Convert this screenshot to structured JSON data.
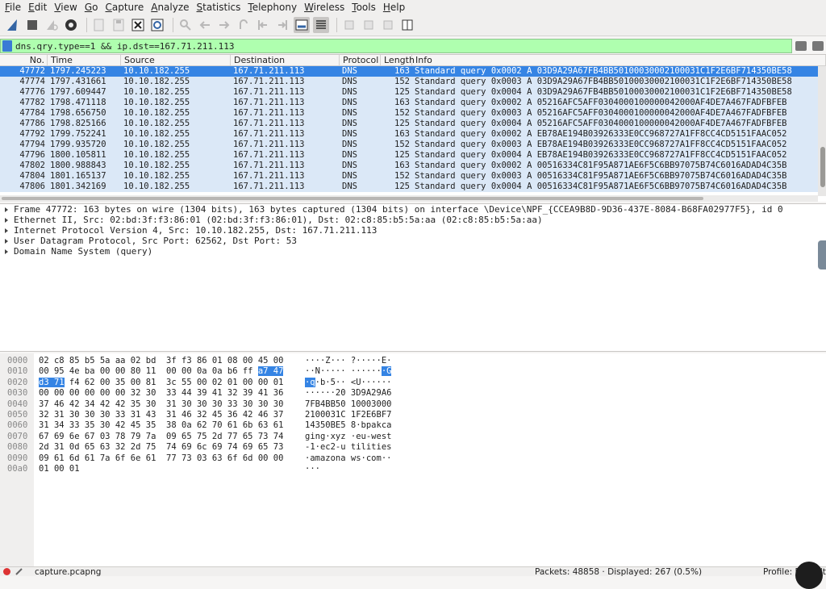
{
  "menu": [
    "File",
    "Edit",
    "View",
    "Go",
    "Capture",
    "Analyze",
    "Statistics",
    "Telephony",
    "Wireless",
    "Tools",
    "Help"
  ],
  "toolbar_icons": [
    "shark-fin-start-icon",
    "stop-icon",
    "restart-icon",
    "options-gear-icon",
    "open-file-icon",
    "save-file-icon",
    "close-file-icon",
    "reload-file-icon",
    "find-icon",
    "back-icon",
    "forward-icon",
    "go-to-packet-icon",
    "first-packet-icon",
    "last-packet-icon",
    "autoscroll-icon",
    "colorize-icon",
    "zoom-in-icon",
    "zoom-out-icon",
    "normal-size-icon",
    "resize-columns-icon"
  ],
  "filter": {
    "value": "dns.qry.type==1 && ip.dst==167.71.211.113"
  },
  "columns": [
    "No.",
    "Time",
    "Source",
    "Destination",
    "Protocol",
    "Length",
    "Info"
  ],
  "packets": [
    {
      "no": "47772",
      "time": "1797.245223",
      "src": "10.10.182.255",
      "dst": "167.71.211.113",
      "proto": "DNS",
      "len": "163",
      "info": "Standard query 0x0002 A 03D9A29A67FB4BB50100030002100031C1F2E6BF714350BE58",
      "selected": true
    },
    {
      "no": "47774",
      "time": "1797.431661",
      "src": "10.10.182.255",
      "dst": "167.71.211.113",
      "proto": "DNS",
      "len": "152",
      "info": "Standard query 0x0003 A 03D9A29A67FB4BB50100030002100031C1F2E6BF714350BE58"
    },
    {
      "no": "47776",
      "time": "1797.609447",
      "src": "10.10.182.255",
      "dst": "167.71.211.113",
      "proto": "DNS",
      "len": "125",
      "info": "Standard query 0x0004 A 03D9A29A67FB4BB50100030002100031C1F2E6BF714350BE58"
    },
    {
      "no": "47782",
      "time": "1798.471118",
      "src": "10.10.182.255",
      "dst": "167.71.211.113",
      "proto": "DNS",
      "len": "163",
      "info": "Standard query 0x0002 A 05216AFC5AFF0304000100000042000AF4DE7A467FADFBFEB"
    },
    {
      "no": "47784",
      "time": "1798.656750",
      "src": "10.10.182.255",
      "dst": "167.71.211.113",
      "proto": "DNS",
      "len": "152",
      "info": "Standard query 0x0003 A 05216AFC5AFF0304000100000042000AF4DE7A467FADFBFEB"
    },
    {
      "no": "47786",
      "time": "1798.825166",
      "src": "10.10.182.255",
      "dst": "167.71.211.113",
      "proto": "DNS",
      "len": "125",
      "info": "Standard query 0x0004 A 05216AFC5AFF0304000100000042000AF4DE7A467FADFBFEB"
    },
    {
      "no": "47792",
      "time": "1799.752241",
      "src": "10.10.182.255",
      "dst": "167.71.211.113",
      "proto": "DNS",
      "len": "163",
      "info": "Standard query 0x0002 A EB78AE194B03926333E0CC968727A1FF8CC4CD5151FAAC052"
    },
    {
      "no": "47794",
      "time": "1799.935720",
      "src": "10.10.182.255",
      "dst": "167.71.211.113",
      "proto": "DNS",
      "len": "152",
      "info": "Standard query 0x0003 A EB78AE194B03926333E0CC968727A1FF8CC4CD5151FAAC052"
    },
    {
      "no": "47796",
      "time": "1800.105811",
      "src": "10.10.182.255",
      "dst": "167.71.211.113",
      "proto": "DNS",
      "len": "125",
      "info": "Standard query 0x0004 A EB78AE194B03926333E0CC968727A1FF8CC4CD5151FAAC052"
    },
    {
      "no": "47802",
      "time": "1800.988843",
      "src": "10.10.182.255",
      "dst": "167.71.211.113",
      "proto": "DNS",
      "len": "163",
      "info": "Standard query 0x0002 A 00516334C81F95A871AE6F5C6BB97075B74C6016ADAD4C35B"
    },
    {
      "no": "47804",
      "time": "1801.165137",
      "src": "10.10.182.255",
      "dst": "167.71.211.113",
      "proto": "DNS",
      "len": "152",
      "info": "Standard query 0x0003 A 00516334C81F95A871AE6F5C6BB97075B74C6016ADAD4C35B"
    },
    {
      "no": "47806",
      "time": "1801.342169",
      "src": "10.10.182.255",
      "dst": "167.71.211.113",
      "proto": "DNS",
      "len": "125",
      "info": "Standard query 0x0004 A 00516334C81F95A871AE6F5C6BB97075B74C6016ADAD4C35B"
    }
  ],
  "details": [
    "Frame 47772: 163 bytes on wire (1304 bits), 163 bytes captured (1304 bits) on interface \\Device\\NPF_{CCEA9B8D-9D36-437E-8084-B68FA02977F5}, id 0",
    "Ethernet II, Src: 02:bd:3f:f3:86:01 (02:bd:3f:f3:86:01), Dst: 02:c8:85:b5:5a:aa (02:c8:85:b5:5a:aa)",
    "Internet Protocol Version 4, Src: 10.10.182.255, Dst: 167.71.211.113",
    "User Datagram Protocol, Src Port: 62562, Dst Port: 53",
    "Domain Name System (query)"
  ],
  "hex": [
    {
      "off": "0000",
      "pre": "02 c8 85 b5 5a aa 02 bd  3f f3 86 01 08 00 45 00",
      "hl": "",
      "post": "",
      "apre": "····Z··· ?·····E·",
      "ahl": "",
      "apost": ""
    },
    {
      "off": "0010",
      "pre": "00 95 4e ba 00 00 80 11  00 00 0a 0a b6 ff ",
      "hl": "a7 47",
      "post": "",
      "apre": "··N····· ······",
      "ahl": "·G",
      "apost": ""
    },
    {
      "off": "0020",
      "pre": "",
      "hl": "d3 71",
      "post": " f4 62 00 35 00 81  3c 55 00 02 01 00 00 01",
      "apre": "",
      "ahl": "·q",
      "apost": "·b·5·· <U······"
    },
    {
      "off": "0030",
      "pre": "00 00 00 00 00 00 32 30  33 44 39 41 32 39 41 36",
      "hl": "",
      "post": "",
      "apre": "······20 3D9A29A6",
      "ahl": "",
      "apost": ""
    },
    {
      "off": "0040",
      "pre": "37 46 42 34 42 42 35 30  31 30 30 30 33 30 30 30",
      "hl": "",
      "post": "",
      "apre": "7FB4BB50 10003000",
      "ahl": "",
      "apost": ""
    },
    {
      "off": "0050",
      "pre": "32 31 30 30 30 33 31 43  31 46 32 45 36 42 46 37",
      "hl": "",
      "post": "",
      "apre": "2100031C 1F2E6BF7",
      "ahl": "",
      "apost": ""
    },
    {
      "off": "0060",
      "pre": "31 34 33 35 30 42 45 35  38 0a 62 70 61 6b 63 61",
      "hl": "",
      "post": "",
      "apre": "14350BE5 8·bpakca",
      "ahl": "",
      "apost": ""
    },
    {
      "off": "0070",
      "pre": "67 69 6e 67 03 78 79 7a  09 65 75 2d 77 65 73 74",
      "hl": "",
      "post": "",
      "apre": "ging·xyz ·eu-west",
      "ahl": "",
      "apost": ""
    },
    {
      "off": "0080",
      "pre": "2d 31 0d 65 63 32 2d 75  74 69 6c 69 74 69 65 73",
      "hl": "",
      "post": "",
      "apre": "-1·ec2-u tilities",
      "ahl": "",
      "apost": ""
    },
    {
      "off": "0090",
      "pre": "09 61 6d 61 7a 6f 6e 61  77 73 03 63 6f 6d 00 00",
      "hl": "",
      "post": "",
      "apre": "·amazona ws·com··",
      "ahl": "",
      "apost": ""
    },
    {
      "off": "00a0",
      "pre": "01 00 01",
      "hl": "",
      "post": "",
      "apre": "···",
      "ahl": "",
      "apost": ""
    }
  ],
  "status": {
    "file": "capture.pcapng",
    "packets": "Packets: 48858 · Displayed: 267 (0.5%)",
    "profile": "Profile: Default"
  },
  "colors": {
    "selection": "#3584e4",
    "row_bg": "#dbe8f7",
    "filter_ok": "#afffaf"
  }
}
